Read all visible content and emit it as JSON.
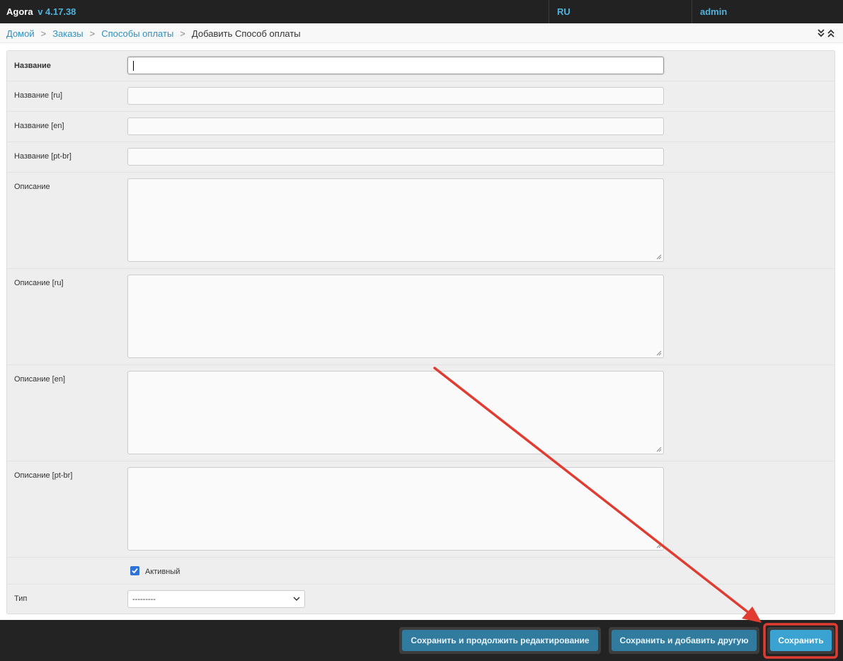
{
  "app": {
    "name": "Agora",
    "version": "v 4.17.38",
    "language": "RU",
    "user": "admin"
  },
  "breadcrumb": {
    "home": "Домой",
    "orders": "Заказы",
    "payment_methods": "Способы оплаты",
    "current": "Добавить Способ оплаты"
  },
  "form": {
    "name_label": "Название",
    "name_ru_label": "Название [ru]",
    "name_en_label": "Название [en]",
    "name_ptbr_label": "Название [pt-br]",
    "desc_label": "Описание",
    "desc_ru_label": "Описание [ru]",
    "desc_en_label": "Описание [en]",
    "desc_ptbr_label": "Описание [pt-br]",
    "active_label": "Активный",
    "active_checked": true,
    "type_label": "Тип",
    "type_value": "---------"
  },
  "actions": {
    "save_continue": "Сохранить и продолжить редактирование",
    "save_add": "Сохранить и добавить другую",
    "save": "Сохранить"
  },
  "colors": {
    "topbar": "#222222",
    "link": "#2e8fbd",
    "button": "#317b9f",
    "primary_button": "#3aa3d1",
    "annotation": "#e03c31"
  }
}
